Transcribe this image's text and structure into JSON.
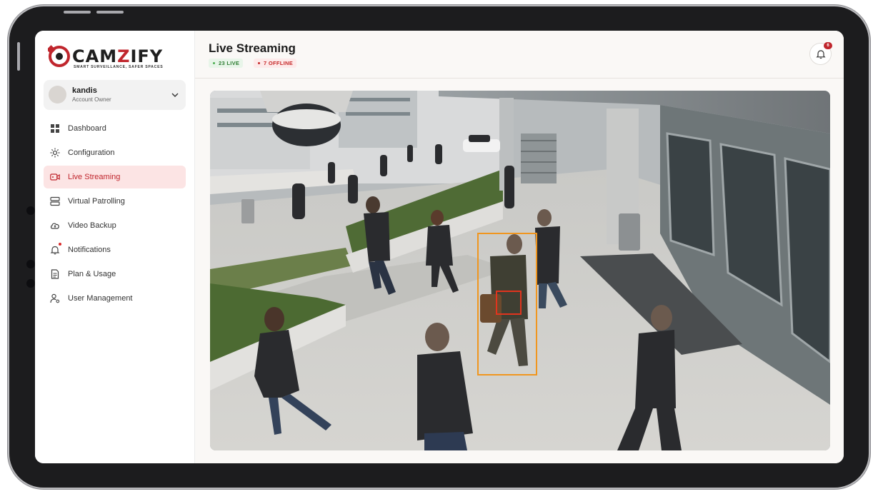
{
  "brand": {
    "name_prefix": "CAM",
    "name_accent": "Z",
    "name_suffix": "IFY",
    "tagline": "SMART SURVEILLANCE, SAFER SPACES"
  },
  "user": {
    "name": "kandis",
    "role": "Account Owner"
  },
  "sidebar": {
    "items": [
      {
        "label": "Dashboard",
        "icon": "grid-icon"
      },
      {
        "label": "Configuration",
        "icon": "sun-gear-icon"
      },
      {
        "label": "Live Streaming",
        "icon": "video-camera-icon",
        "active": true
      },
      {
        "label": "Virtual Patrolling",
        "icon": "server-icon"
      },
      {
        "label": "Video Backup",
        "icon": "cloud-upload-icon"
      },
      {
        "label": "Notifications",
        "icon": "bell-icon"
      },
      {
        "label": "Plan & Usage",
        "icon": "document-icon"
      },
      {
        "label": "User Management",
        "icon": "user-settings-icon"
      }
    ]
  },
  "header": {
    "title": "Live Streaming",
    "live_badge": "23 LIVE",
    "offline_badge": "7 OFFLINE",
    "notification_count": "6"
  },
  "colors": {
    "accent": "#c0262d",
    "active_bg": "#fce4e4",
    "live_green": "#2e7d32",
    "offline_red": "#c62828",
    "detection_primary": "#f0961f",
    "detection_secondary": "#e2341d"
  }
}
